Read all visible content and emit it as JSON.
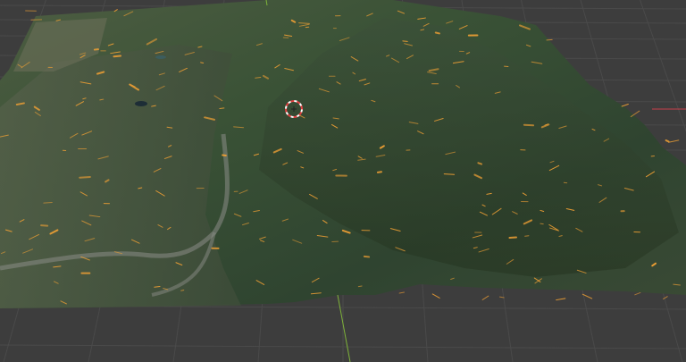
{
  "viewport": {
    "kind": "3D viewport",
    "background_color": "#3d3d3d",
    "grid_color": "#4a4a4a",
    "x_axis_color": "#c8404a",
    "y_axis_color": "#7fb33a"
  },
  "terrain": {
    "kind": "satellite-textured terrain mesh",
    "texture_colors": [
      "#2f4430",
      "#3a5236",
      "#4c5c40",
      "#56604e"
    ],
    "highlight_color": "#f0a034"
  },
  "cursor_3d": {
    "name": "3d-cursor-icon",
    "ring_colors": [
      "#e04040",
      "#ffffff"
    ]
  }
}
